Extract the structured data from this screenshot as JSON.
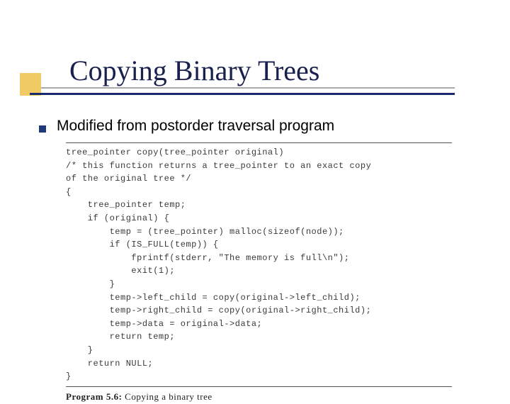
{
  "title": "Copying Binary Trees",
  "subtitle": "Modified from postorder traversal program",
  "code": {
    "l0": "tree_pointer copy(tree_pointer original)",
    "l1": "/* this function returns a tree_pointer to an exact copy",
    "l2": "of the original tree */",
    "l3": "{",
    "l4": "    tree_pointer temp;",
    "l5": "    if (original) {",
    "l6": "        temp = (tree_pointer) malloc(sizeof(node));",
    "l7": "        if (IS_FULL(temp)) {",
    "l8": "            fprintf(stderr, \"The memory is full\\n\");",
    "l9": "            exit(1);",
    "l10": "        }",
    "l11": "        temp->left_child = copy(original->left_child);",
    "l12": "        temp->right_child = copy(original->right_child);",
    "l13": "        temp->data = original->data;",
    "l14": "        return temp;",
    "l15": "    }",
    "l16": "    return NULL;",
    "l17": "}"
  },
  "caption": {
    "label": "Program 5.6:",
    "text": " Copying a binary tree"
  }
}
